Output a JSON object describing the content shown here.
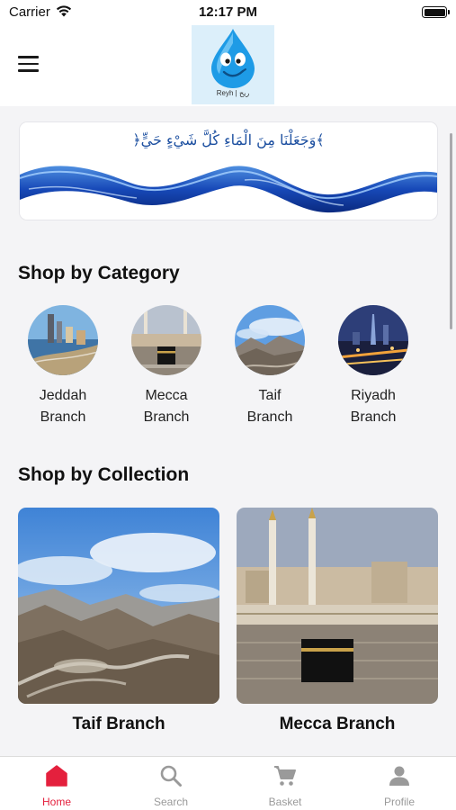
{
  "status_bar": {
    "carrier": "Carrier",
    "time": "12:17 PM"
  },
  "header": {
    "logo_text": "Reyh | ريح"
  },
  "banner": {
    "verse": "﴿وَجَعَلْنَا مِنَ الْمَاءِ كُلَّ شَيْءٍ حَيٍّ﴾"
  },
  "categories": {
    "title": "Shop by Category",
    "items": [
      {
        "line1": "Jeddah",
        "line2": "Branch"
      },
      {
        "line1": "Mecca",
        "line2": "Branch"
      },
      {
        "line1": "Taif",
        "line2": "Branch"
      },
      {
        "line1": "Riyadh",
        "line2": "Branch"
      }
    ]
  },
  "collections": {
    "title": "Shop by Collection",
    "items": [
      {
        "label": "Taif Branch"
      },
      {
        "label": "Mecca Branch"
      }
    ]
  },
  "tab_bar": {
    "active_color": "#e4203d",
    "inactive_color": "#9a9a9a",
    "tabs": [
      {
        "label": "Home",
        "icon": "home-icon",
        "active": true
      },
      {
        "label": "Search",
        "icon": "search-icon",
        "active": false
      },
      {
        "label": "Basket",
        "icon": "cart-icon",
        "active": false
      },
      {
        "label": "Profile",
        "icon": "person-icon",
        "active": false
      }
    ]
  }
}
